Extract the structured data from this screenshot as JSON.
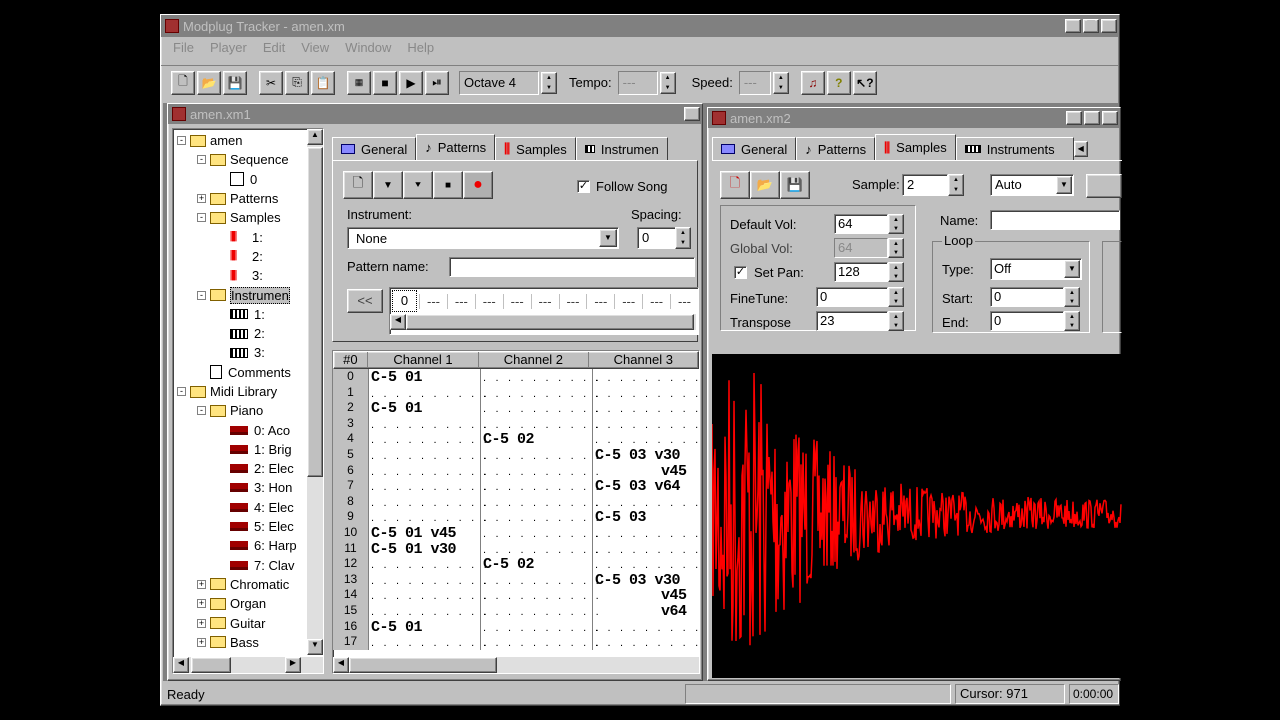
{
  "app": {
    "title": "Modplug Tracker - amen.xm",
    "menu": [
      "File",
      "Player",
      "Edit",
      "View",
      "Window",
      "Help"
    ],
    "toolbar": {
      "octave_label": "Octave 4",
      "tempo_label": "Tempo:",
      "tempo_value": "---",
      "speed_label": "Speed:",
      "speed_value": "---"
    },
    "status": {
      "left": "Ready",
      "cursor": "Cursor: 971",
      "time": "0:00:00"
    }
  },
  "win1": {
    "title": "amen.xm1",
    "tree": [
      {
        "label": "amen",
        "indent": 0,
        "exp": "-",
        "icon": "folder"
      },
      {
        "label": "Sequence",
        "indent": 1,
        "exp": "-",
        "icon": "folder"
      },
      {
        "label": "0",
        "indent": 2,
        "exp": "",
        "icon": "seq"
      },
      {
        "label": "Patterns",
        "indent": 1,
        "exp": "+",
        "icon": "folder"
      },
      {
        "label": "Samples",
        "indent": 1,
        "exp": "-",
        "icon": "folder"
      },
      {
        "label": "1:",
        "indent": 2,
        "exp": "",
        "icon": "smp"
      },
      {
        "label": "2:",
        "indent": 2,
        "exp": "",
        "icon": "smp"
      },
      {
        "label": "3:",
        "indent": 2,
        "exp": "",
        "icon": "smp"
      },
      {
        "label": "Instrumen",
        "indent": 1,
        "exp": "-",
        "icon": "folder",
        "selected": true
      },
      {
        "label": "1:",
        "indent": 2,
        "exp": "",
        "icon": "ins"
      },
      {
        "label": "2:",
        "indent": 2,
        "exp": "",
        "icon": "ins"
      },
      {
        "label": "3:",
        "indent": 2,
        "exp": "",
        "icon": "ins"
      },
      {
        "label": "Comments",
        "indent": 1,
        "exp": "",
        "icon": "doc"
      },
      {
        "label": "Midi Library",
        "indent": 0,
        "exp": "-",
        "icon": "folder"
      },
      {
        "label": "Piano",
        "indent": 1,
        "exp": "-",
        "icon": "folder"
      },
      {
        "label": "0: Aco",
        "indent": 2,
        "exp": "",
        "icon": "midi"
      },
      {
        "label": "1: Brig",
        "indent": 2,
        "exp": "",
        "icon": "midi"
      },
      {
        "label": "2: Elec",
        "indent": 2,
        "exp": "",
        "icon": "midi"
      },
      {
        "label": "3: Hon",
        "indent": 2,
        "exp": "",
        "icon": "midi"
      },
      {
        "label": "4: Elec",
        "indent": 2,
        "exp": "",
        "icon": "midi"
      },
      {
        "label": "5: Elec",
        "indent": 2,
        "exp": "",
        "icon": "midi"
      },
      {
        "label": "6: Harp",
        "indent": 2,
        "exp": "",
        "icon": "midi"
      },
      {
        "label": "7: Clav",
        "indent": 2,
        "exp": "",
        "icon": "midi"
      },
      {
        "label": "Chromatic",
        "indent": 1,
        "exp": "+",
        "icon": "folder"
      },
      {
        "label": "Organ",
        "indent": 1,
        "exp": "+",
        "icon": "folder"
      },
      {
        "label": "Guitar",
        "indent": 1,
        "exp": "+",
        "icon": "folder"
      },
      {
        "label": "Bass",
        "indent": 1,
        "exp": "+",
        "icon": "folder"
      }
    ],
    "tabs": [
      "General",
      "Patterns",
      "Samples",
      "Instrumen"
    ],
    "follow_song": "Follow Song",
    "instrument_label": "Instrument:",
    "instrument_value": "None",
    "spacing_label": "Spacing:",
    "spacing_value": "0",
    "pattern_name_label": "Pattern name:",
    "pattern_name_value": "",
    "order_back": "<<",
    "order_first": "0",
    "order_empty": "---",
    "pattern_header": [
      "#0",
      "Channel 1",
      "Channel 2",
      "Channel 3"
    ],
    "rows": [
      {
        "n": "0",
        "c1": "C-5 01",
        "c2": "",
        "c3": ""
      },
      {
        "n": "1",
        "c1": "",
        "c2": "",
        "c3": ""
      },
      {
        "n": "2",
        "c1": "C-5 01",
        "c2": "",
        "c3": ""
      },
      {
        "n": "3",
        "c1": "",
        "c2": "",
        "c3": ""
      },
      {
        "n": "4",
        "c1": "",
        "c2": "C-5 02",
        "c3": ""
      },
      {
        "n": "5",
        "c1": "",
        "c2": "",
        "c3": "C-5 03 v30"
      },
      {
        "n": "6",
        "c1": "",
        "c2": "",
        "c3": "v45"
      },
      {
        "n": "7",
        "c1": "",
        "c2": "",
        "c3": "C-5 03 v64"
      },
      {
        "n": "8",
        "c1": "",
        "c2": "",
        "c3": ""
      },
      {
        "n": "9",
        "c1": "",
        "c2": "",
        "c3": "C-5 03"
      },
      {
        "n": "10",
        "c1": "C-5 01 v45",
        "c2": "",
        "c3": ""
      },
      {
        "n": "11",
        "c1": "C-5 01 v30",
        "c2": "",
        "c3": ""
      },
      {
        "n": "12",
        "c1": "",
        "c2": "C-5 02",
        "c3": ""
      },
      {
        "n": "13",
        "c1": "",
        "c2": "",
        "c3": "C-5 03 v30"
      },
      {
        "n": "14",
        "c1": "",
        "c2": "",
        "c3": "v45"
      },
      {
        "n": "15",
        "c1": "",
        "c2": "",
        "c3": "v64"
      },
      {
        "n": "16",
        "c1": "C-5 01",
        "c2": "",
        "c3": ""
      },
      {
        "n": "17",
        "c1": "",
        "c2": "",
        "c3": ""
      }
    ]
  },
  "win2": {
    "title": "amen.xm2",
    "tabs": [
      "General",
      "Patterns",
      "Samples",
      "Instruments"
    ],
    "sample_label": "Sample:",
    "sample_value": "2",
    "mode_value": "Auto",
    "default_vol_label": "Default Vol:",
    "default_vol_value": "64",
    "global_vol_label": "Global Vol:",
    "global_vol_value": "64",
    "set_pan_label": "Set Pan:",
    "set_pan_value": "128",
    "finetune_label": "FineTune:",
    "finetune_value": "0",
    "transpose_label": "Transpose",
    "transpose_value": "23",
    "name_label": "Name:",
    "name_value": "",
    "loop_group": "Loop",
    "loop_type_label": "Type:",
    "loop_type_value": "Off",
    "loop_start_label": "Start:",
    "loop_start_value": "0",
    "loop_end_label": "End:",
    "loop_end_value": "0",
    "waveform_color": "#ff0000"
  }
}
